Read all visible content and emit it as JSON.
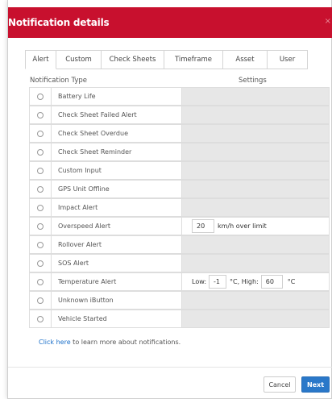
{
  "dialog": {
    "title": "Notification details",
    "close_icon": "×"
  },
  "tabs": [
    "Alert",
    "Custom",
    "Check Sheets",
    "Timeframe",
    "Asset",
    "User"
  ],
  "table": {
    "type_header": "Notification Type",
    "settings_header": "Settings",
    "rows": [
      {
        "label": "Battery Life"
      },
      {
        "label": "Check Sheet Failed Alert"
      },
      {
        "label": "Check Sheet Overdue"
      },
      {
        "label": "Check Sheet Reminder"
      },
      {
        "label": "Custom Input"
      },
      {
        "label": "GPS Unit Offline"
      },
      {
        "label": "Impact Alert"
      },
      {
        "label": "Overspeed Alert"
      },
      {
        "label": "Rollover Alert"
      },
      {
        "label": "SOS Alert"
      },
      {
        "label": "Temperature Alert"
      },
      {
        "label": "Unknown iButton"
      },
      {
        "label": "Vehicle Started"
      }
    ]
  },
  "overspeed": {
    "value": "20",
    "unit": "km/h over limit"
  },
  "temperature": {
    "low_label": "Low:",
    "low_value": "-1",
    "high_label": "°C, High:",
    "high_value": "60",
    "unit": "°C"
  },
  "help": {
    "link": "Click here",
    "text": " to learn more about notifications."
  },
  "buttons": {
    "cancel": "Cancel",
    "next": "Next"
  },
  "colors": {
    "header": "#c8102e",
    "primary": "#2a78c9",
    "link": "#1a6fc9"
  }
}
